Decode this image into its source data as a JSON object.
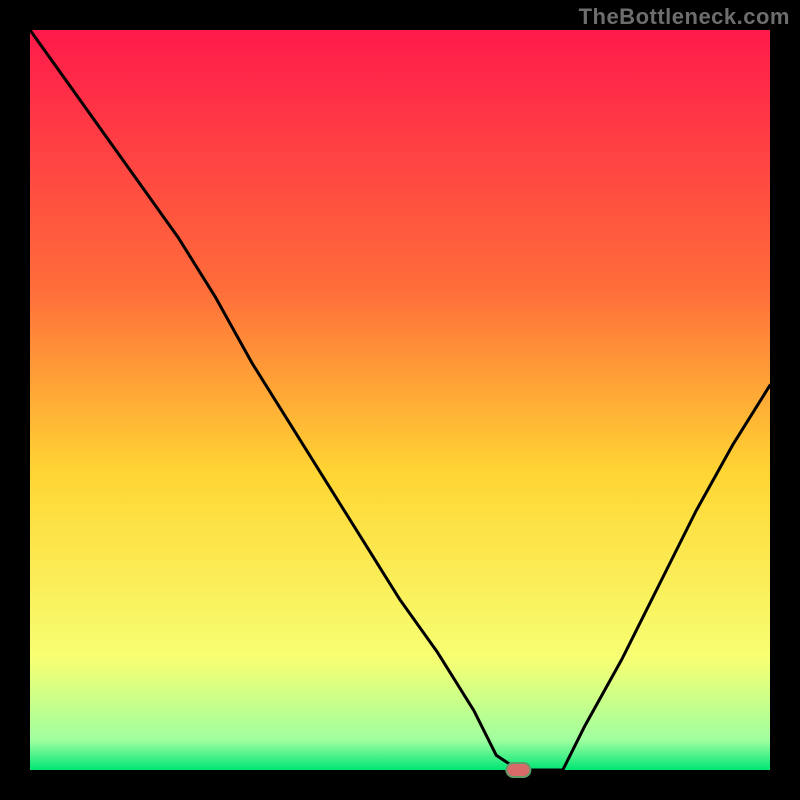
{
  "watermark": "TheBottleneck.com",
  "colors": {
    "black": "#000000",
    "line": "#000000",
    "marker_fill": "#d96a6a",
    "marker_stroke": "#5f9c6a"
  },
  "chart_data": {
    "type": "line",
    "title": "",
    "xlabel": "",
    "ylabel": "",
    "xlim": [
      0,
      100
    ],
    "ylim": [
      0,
      100
    ],
    "x": [
      0,
      5,
      10,
      15,
      20,
      25,
      30,
      35,
      40,
      45,
      50,
      55,
      60,
      63,
      66,
      72,
      75,
      80,
      85,
      90,
      95,
      100
    ],
    "values": [
      100,
      93,
      86,
      79,
      72,
      64,
      55,
      47,
      39,
      31,
      23,
      16,
      8,
      2,
      0,
      0,
      6,
      15,
      25,
      35,
      44,
      52
    ],
    "marker": {
      "x": 66,
      "y": 0
    },
    "background_gradient": [
      "#ff1a4b",
      "#ff6d3a",
      "#ffd633",
      "#f7ff73",
      "#9fff9f",
      "#00e676"
    ]
  }
}
